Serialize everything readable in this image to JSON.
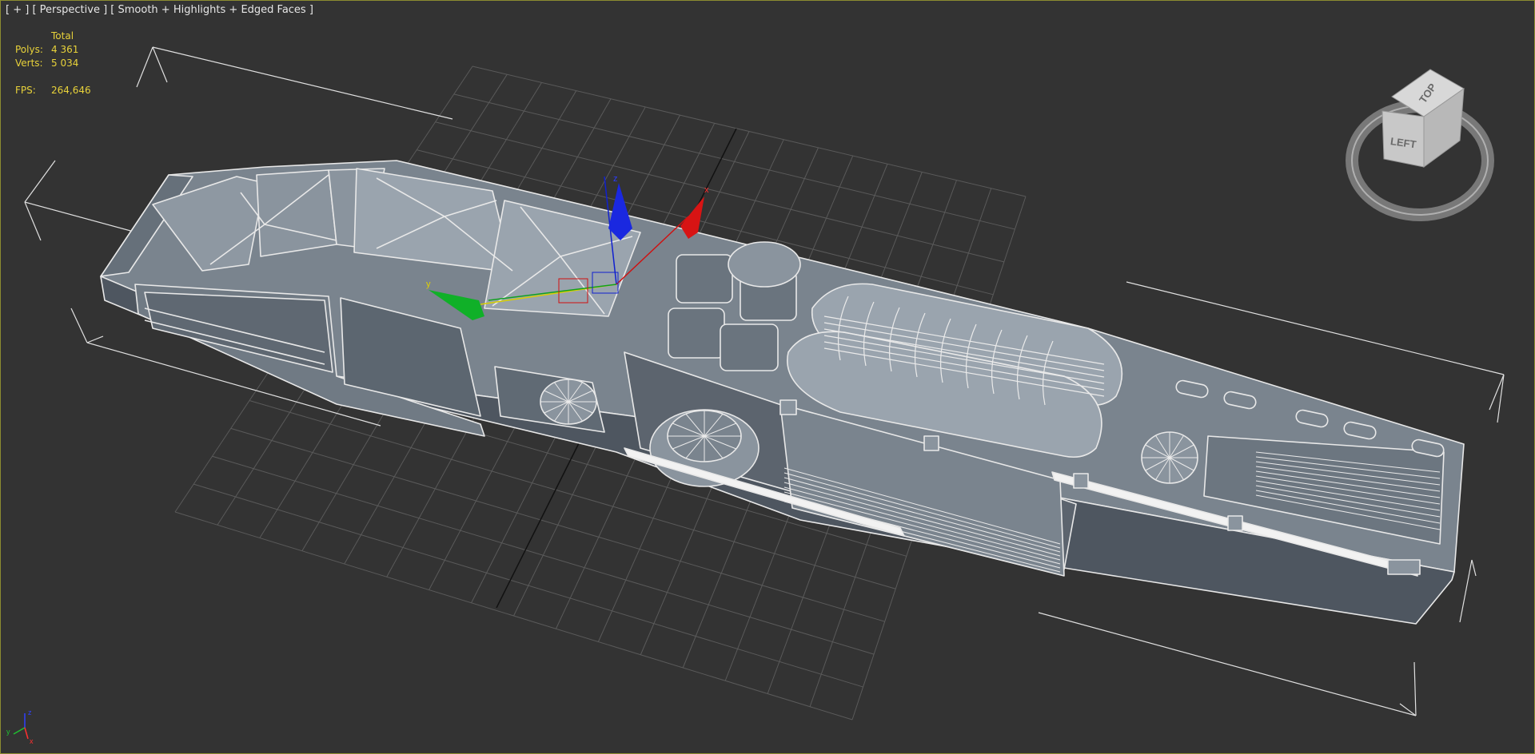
{
  "viewport": {
    "label_plus": "[ + ]",
    "label_view": "[ Perspective ]",
    "label_shading": "[ Smooth + Highlights + Edged Faces ]",
    "frame_color": "#8c8c30",
    "background_color": "#333333"
  },
  "stats": {
    "header": "Total",
    "polys_label": "Polys:",
    "polys_value": "4 361",
    "verts_label": "Verts:",
    "verts_value": "5 034",
    "fps_label": "FPS:",
    "fps_value": "264,646",
    "text_color": "#e8d23a"
  },
  "viewcube": {
    "face_top": "TOP",
    "face_left": "LEFT",
    "icon": "viewcube-icon"
  },
  "gizmo": {
    "x_label": "x",
    "y_label": "y",
    "z_label": "z",
    "x_color": "#d01010",
    "y_color": "#10a020",
    "z_color": "#1020d0"
  },
  "axis_tripod": {
    "x_label": "x",
    "y_label": "y",
    "z_label": "z"
  },
  "colors": {
    "grid": "#5a5a5a",
    "mesh_face": "#6f7984",
    "mesh_face_light": "#8a949e",
    "mesh_face_dark": "#4e5660",
    "edge": "#e8e8e8",
    "bbox": "#e0e0e0"
  }
}
